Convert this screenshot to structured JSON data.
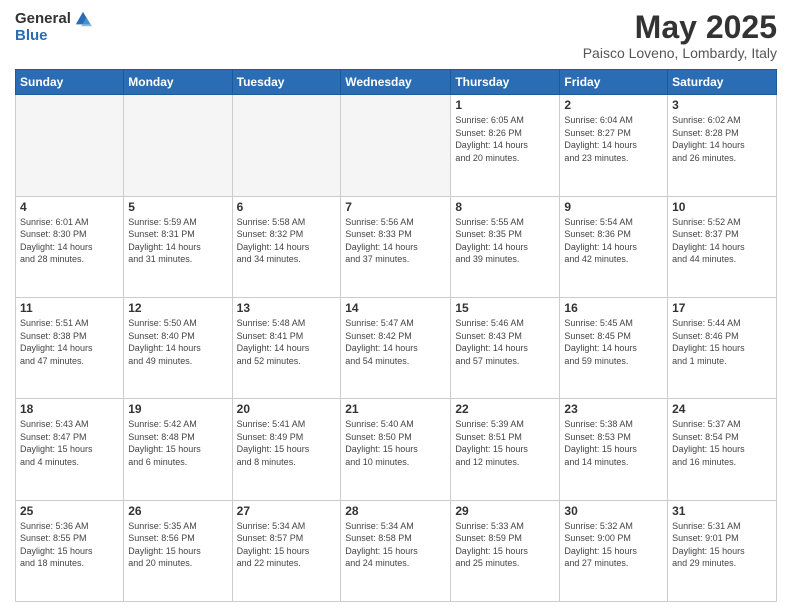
{
  "header": {
    "logo_general": "General",
    "logo_blue": "Blue",
    "title": "May 2025",
    "location": "Paisco Loveno, Lombardy, Italy"
  },
  "days_of_week": [
    "Sunday",
    "Monday",
    "Tuesday",
    "Wednesday",
    "Thursday",
    "Friday",
    "Saturday"
  ],
  "weeks": [
    [
      {
        "day": "",
        "info": ""
      },
      {
        "day": "",
        "info": ""
      },
      {
        "day": "",
        "info": ""
      },
      {
        "day": "",
        "info": ""
      },
      {
        "day": "1",
        "info": "Sunrise: 6:05 AM\nSunset: 8:26 PM\nDaylight: 14 hours\nand 20 minutes."
      },
      {
        "day": "2",
        "info": "Sunrise: 6:04 AM\nSunset: 8:27 PM\nDaylight: 14 hours\nand 23 minutes."
      },
      {
        "day": "3",
        "info": "Sunrise: 6:02 AM\nSunset: 8:28 PM\nDaylight: 14 hours\nand 26 minutes."
      }
    ],
    [
      {
        "day": "4",
        "info": "Sunrise: 6:01 AM\nSunset: 8:30 PM\nDaylight: 14 hours\nand 28 minutes."
      },
      {
        "day": "5",
        "info": "Sunrise: 5:59 AM\nSunset: 8:31 PM\nDaylight: 14 hours\nand 31 minutes."
      },
      {
        "day": "6",
        "info": "Sunrise: 5:58 AM\nSunset: 8:32 PM\nDaylight: 14 hours\nand 34 minutes."
      },
      {
        "day": "7",
        "info": "Sunrise: 5:56 AM\nSunset: 8:33 PM\nDaylight: 14 hours\nand 37 minutes."
      },
      {
        "day": "8",
        "info": "Sunrise: 5:55 AM\nSunset: 8:35 PM\nDaylight: 14 hours\nand 39 minutes."
      },
      {
        "day": "9",
        "info": "Sunrise: 5:54 AM\nSunset: 8:36 PM\nDaylight: 14 hours\nand 42 minutes."
      },
      {
        "day": "10",
        "info": "Sunrise: 5:52 AM\nSunset: 8:37 PM\nDaylight: 14 hours\nand 44 minutes."
      }
    ],
    [
      {
        "day": "11",
        "info": "Sunrise: 5:51 AM\nSunset: 8:38 PM\nDaylight: 14 hours\nand 47 minutes."
      },
      {
        "day": "12",
        "info": "Sunrise: 5:50 AM\nSunset: 8:40 PM\nDaylight: 14 hours\nand 49 minutes."
      },
      {
        "day": "13",
        "info": "Sunrise: 5:48 AM\nSunset: 8:41 PM\nDaylight: 14 hours\nand 52 minutes."
      },
      {
        "day": "14",
        "info": "Sunrise: 5:47 AM\nSunset: 8:42 PM\nDaylight: 14 hours\nand 54 minutes."
      },
      {
        "day": "15",
        "info": "Sunrise: 5:46 AM\nSunset: 8:43 PM\nDaylight: 14 hours\nand 57 minutes."
      },
      {
        "day": "16",
        "info": "Sunrise: 5:45 AM\nSunset: 8:45 PM\nDaylight: 14 hours\nand 59 minutes."
      },
      {
        "day": "17",
        "info": "Sunrise: 5:44 AM\nSunset: 8:46 PM\nDaylight: 15 hours\nand 1 minute."
      }
    ],
    [
      {
        "day": "18",
        "info": "Sunrise: 5:43 AM\nSunset: 8:47 PM\nDaylight: 15 hours\nand 4 minutes."
      },
      {
        "day": "19",
        "info": "Sunrise: 5:42 AM\nSunset: 8:48 PM\nDaylight: 15 hours\nand 6 minutes."
      },
      {
        "day": "20",
        "info": "Sunrise: 5:41 AM\nSunset: 8:49 PM\nDaylight: 15 hours\nand 8 minutes."
      },
      {
        "day": "21",
        "info": "Sunrise: 5:40 AM\nSunset: 8:50 PM\nDaylight: 15 hours\nand 10 minutes."
      },
      {
        "day": "22",
        "info": "Sunrise: 5:39 AM\nSunset: 8:51 PM\nDaylight: 15 hours\nand 12 minutes."
      },
      {
        "day": "23",
        "info": "Sunrise: 5:38 AM\nSunset: 8:53 PM\nDaylight: 15 hours\nand 14 minutes."
      },
      {
        "day": "24",
        "info": "Sunrise: 5:37 AM\nSunset: 8:54 PM\nDaylight: 15 hours\nand 16 minutes."
      }
    ],
    [
      {
        "day": "25",
        "info": "Sunrise: 5:36 AM\nSunset: 8:55 PM\nDaylight: 15 hours\nand 18 minutes."
      },
      {
        "day": "26",
        "info": "Sunrise: 5:35 AM\nSunset: 8:56 PM\nDaylight: 15 hours\nand 20 minutes."
      },
      {
        "day": "27",
        "info": "Sunrise: 5:34 AM\nSunset: 8:57 PM\nDaylight: 15 hours\nand 22 minutes."
      },
      {
        "day": "28",
        "info": "Sunrise: 5:34 AM\nSunset: 8:58 PM\nDaylight: 15 hours\nand 24 minutes."
      },
      {
        "day": "29",
        "info": "Sunrise: 5:33 AM\nSunset: 8:59 PM\nDaylight: 15 hours\nand 25 minutes."
      },
      {
        "day": "30",
        "info": "Sunrise: 5:32 AM\nSunset: 9:00 PM\nDaylight: 15 hours\nand 27 minutes."
      },
      {
        "day": "31",
        "info": "Sunrise: 5:31 AM\nSunset: 9:01 PM\nDaylight: 15 hours\nand 29 minutes."
      }
    ]
  ]
}
